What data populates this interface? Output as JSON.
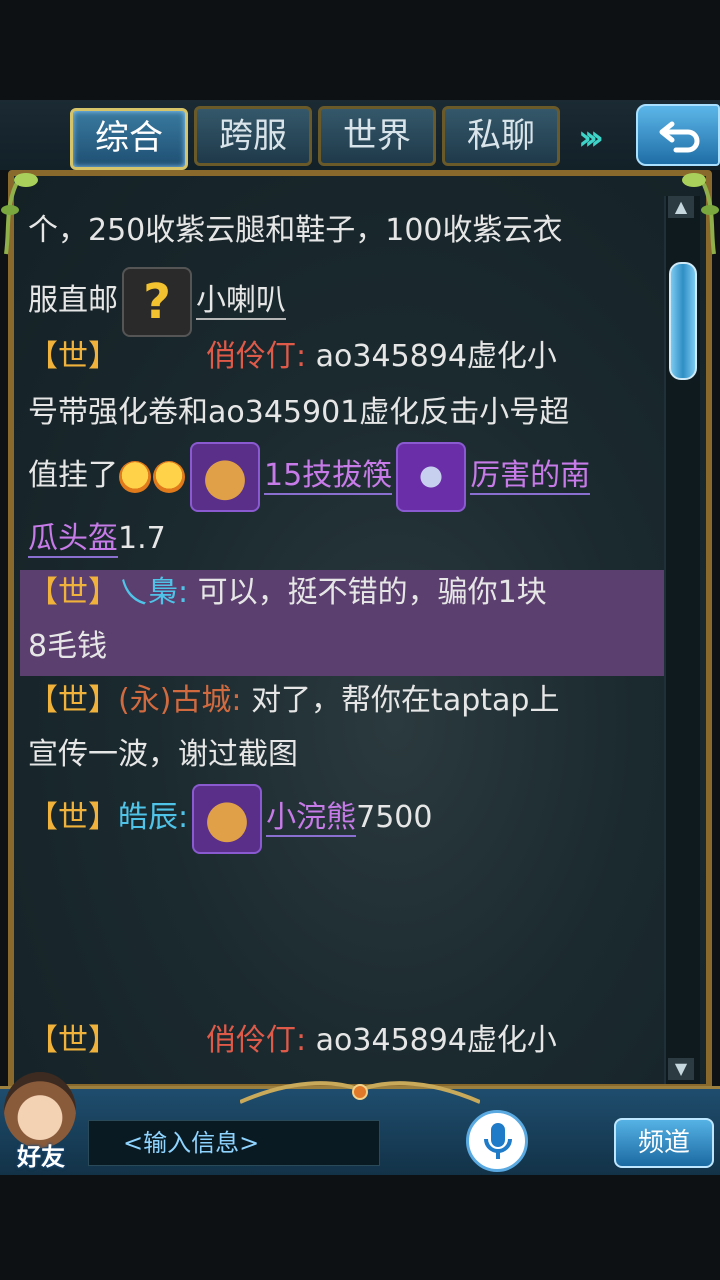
{
  "tabs": [
    {
      "label": "综合",
      "active": true
    },
    {
      "label": "跨服",
      "active": false
    },
    {
      "label": "世界",
      "active": false
    },
    {
      "label": "私聊",
      "active": false
    }
  ],
  "messages": {
    "m1": {
      "text1": "个，250收紫云腿和鞋子，100收紫云衣",
      "text2": "服直邮",
      "item": "小喇叭"
    },
    "m2": {
      "channel": "【世】",
      "name": "俏伶仃:",
      "text1": "ao345894虚化小",
      "text2": "号带强化卷和ao345901虚化反击小号超",
      "text3": "值挂了",
      "item1": "15技拔筷",
      "item2a": "厉害的南",
      "item2b": "瓜头盔",
      "text4": "1.7"
    },
    "m3": {
      "channel": "【世】",
      "name": "乀梟:",
      "text1": "可以，挺不错的，骗你1块",
      "text2": "8毛钱"
    },
    "m4": {
      "channel": "【世】",
      "name": "(永)古城:",
      "text1": "对了，帮你在taptap上",
      "text2": "宣传一波，谢过截图"
    },
    "m5": {
      "channel": "【世】",
      "name": "皓辰:",
      "item": "小浣熊",
      "text": "7500"
    },
    "m6": {
      "channel": "【世】",
      "name": "俏伶仃:",
      "text1": "ao345894虚化小"
    }
  },
  "bottom": {
    "friends_label": "好友",
    "input_placeholder": "<输入信息>",
    "channel_button": "频道"
  },
  "colors": {
    "world_channel": "#f0b23a",
    "item_link": "#c77be8",
    "highlight_row": "#5b3f6e"
  }
}
